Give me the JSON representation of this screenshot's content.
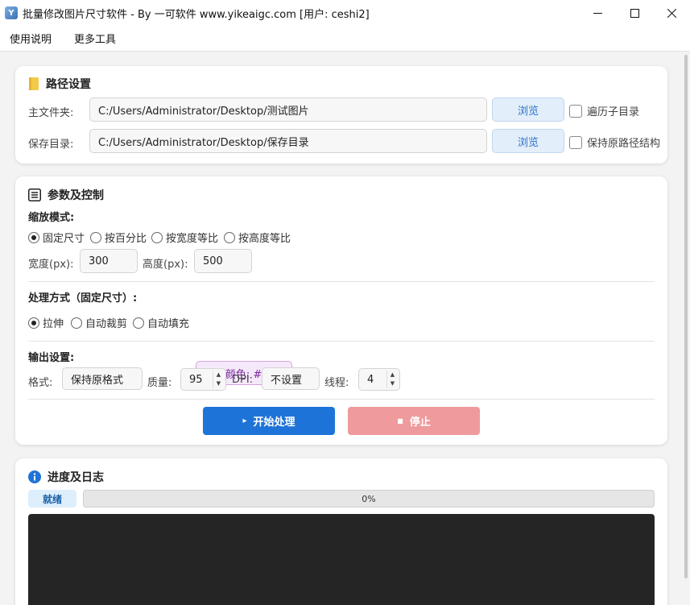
{
  "window": {
    "title": "批量修改图片尺寸软件 - By 一可软件 www.yikeaigc.com [用户: ceshi2]",
    "minimize_glyph": "—",
    "maximize_glyph": "☐",
    "close_glyph": "✕"
  },
  "menu": [
    "使用说明",
    "更多工具"
  ],
  "path_section": {
    "title": "路径设置",
    "main_folder_label": "主文件夹:",
    "main_folder_value": "C:/Users/Administrator/Desktop/测试图片",
    "browse_label": "浏览",
    "recurse_label": "遍历子目录",
    "save_dir_label": "保存目录:",
    "save_dir_value": "C:/Users/Administrator/Desktop/保存目录",
    "keep_structure_label": "保持原路径结构"
  },
  "params_section": {
    "title": "参数及控制",
    "scale_mode_label": "缩放模式:",
    "scale_modes": [
      "固定尺寸",
      "按百分比",
      "按宽度等比",
      "按高度等比"
    ],
    "scale_mode_selected": 0,
    "width_label": "宽度(px):",
    "width_value": "300",
    "height_label": "高度(px):",
    "height_value": "500",
    "process_label": "处理方式（固定尺寸）:",
    "process_modes": [
      "拉伸",
      "自动裁剪",
      "自动填充"
    ],
    "process_mode_selected": 0,
    "fill_color_label": "填充颜色: #ffffff",
    "output_label": "输出设置:",
    "format_label": "格式:",
    "format_value": "保持原格式",
    "quality_label": "质量:",
    "quality_value": "95",
    "dpi_label": "DPI:",
    "dpi_value": "不设置",
    "threads_label": "线程:",
    "threads_value": "4",
    "start_label": "开始处理",
    "stop_label": "停止",
    "start_glyph": "▸",
    "stop_glyph": "■"
  },
  "progress_section": {
    "title": "进度及日志",
    "status": "就绪",
    "progress": 0,
    "progress_text": "0%"
  },
  "colors": {
    "accent": "#1e73d8",
    "stop": "#ef9a9d",
    "log_bg": "#252525"
  }
}
